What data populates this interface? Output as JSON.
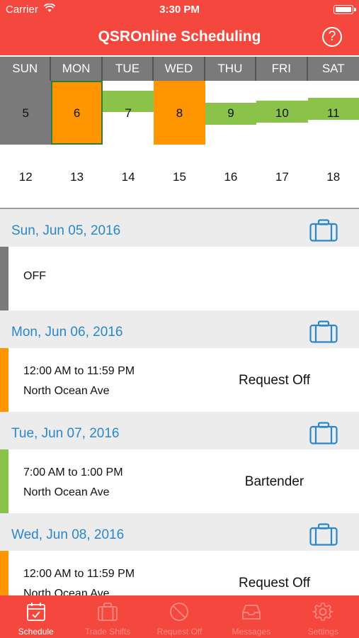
{
  "status": {
    "carrier": "Carrier",
    "time": "3:30 PM"
  },
  "nav": {
    "title": "QSROnline Scheduling",
    "help_glyph": "?"
  },
  "week_days": [
    "SUN",
    "MON",
    "TUE",
    "WED",
    "THU",
    "FRI",
    "SAT"
  ],
  "week1": [
    "5",
    "6",
    "7",
    "8",
    "9",
    "10",
    "11"
  ],
  "week2": [
    "12",
    "13",
    "14",
    "15",
    "16",
    "17",
    "18"
  ],
  "colors": {
    "brand": "#f4473d",
    "off": "#7a7a7a",
    "request_off": "#ff9500",
    "shift": "#8bc34a",
    "date_blue": "#2b87c9",
    "selected_border": "#2e7d32"
  },
  "schedule": [
    {
      "date": "Sun, Jun 05, 2016",
      "status": "OFF"
    },
    {
      "date": "Mon, Jun 06, 2016",
      "time": "12:00 AM to 11:59 PM",
      "location": "North Ocean Ave",
      "role": "Request Off"
    },
    {
      "date": "Tue, Jun 07, 2016",
      "time": "7:00 AM to 1:00 PM",
      "location": "North Ocean Ave",
      "role": "Bartender"
    },
    {
      "date": "Wed, Jun 08, 2016",
      "time": "12:00 AM to 11:59 PM",
      "location": "North Ocean Ave",
      "role": "Request Off"
    }
  ],
  "tabs": [
    {
      "label": "Schedule",
      "icon": "calendar-icon"
    },
    {
      "label": "Trade Shifts",
      "icon": "briefcase-icon"
    },
    {
      "label": "Request Off",
      "icon": "no-entry-icon"
    },
    {
      "label": "Messages",
      "icon": "inbox-icon"
    },
    {
      "label": "Settings",
      "icon": "gear-icon"
    }
  ]
}
